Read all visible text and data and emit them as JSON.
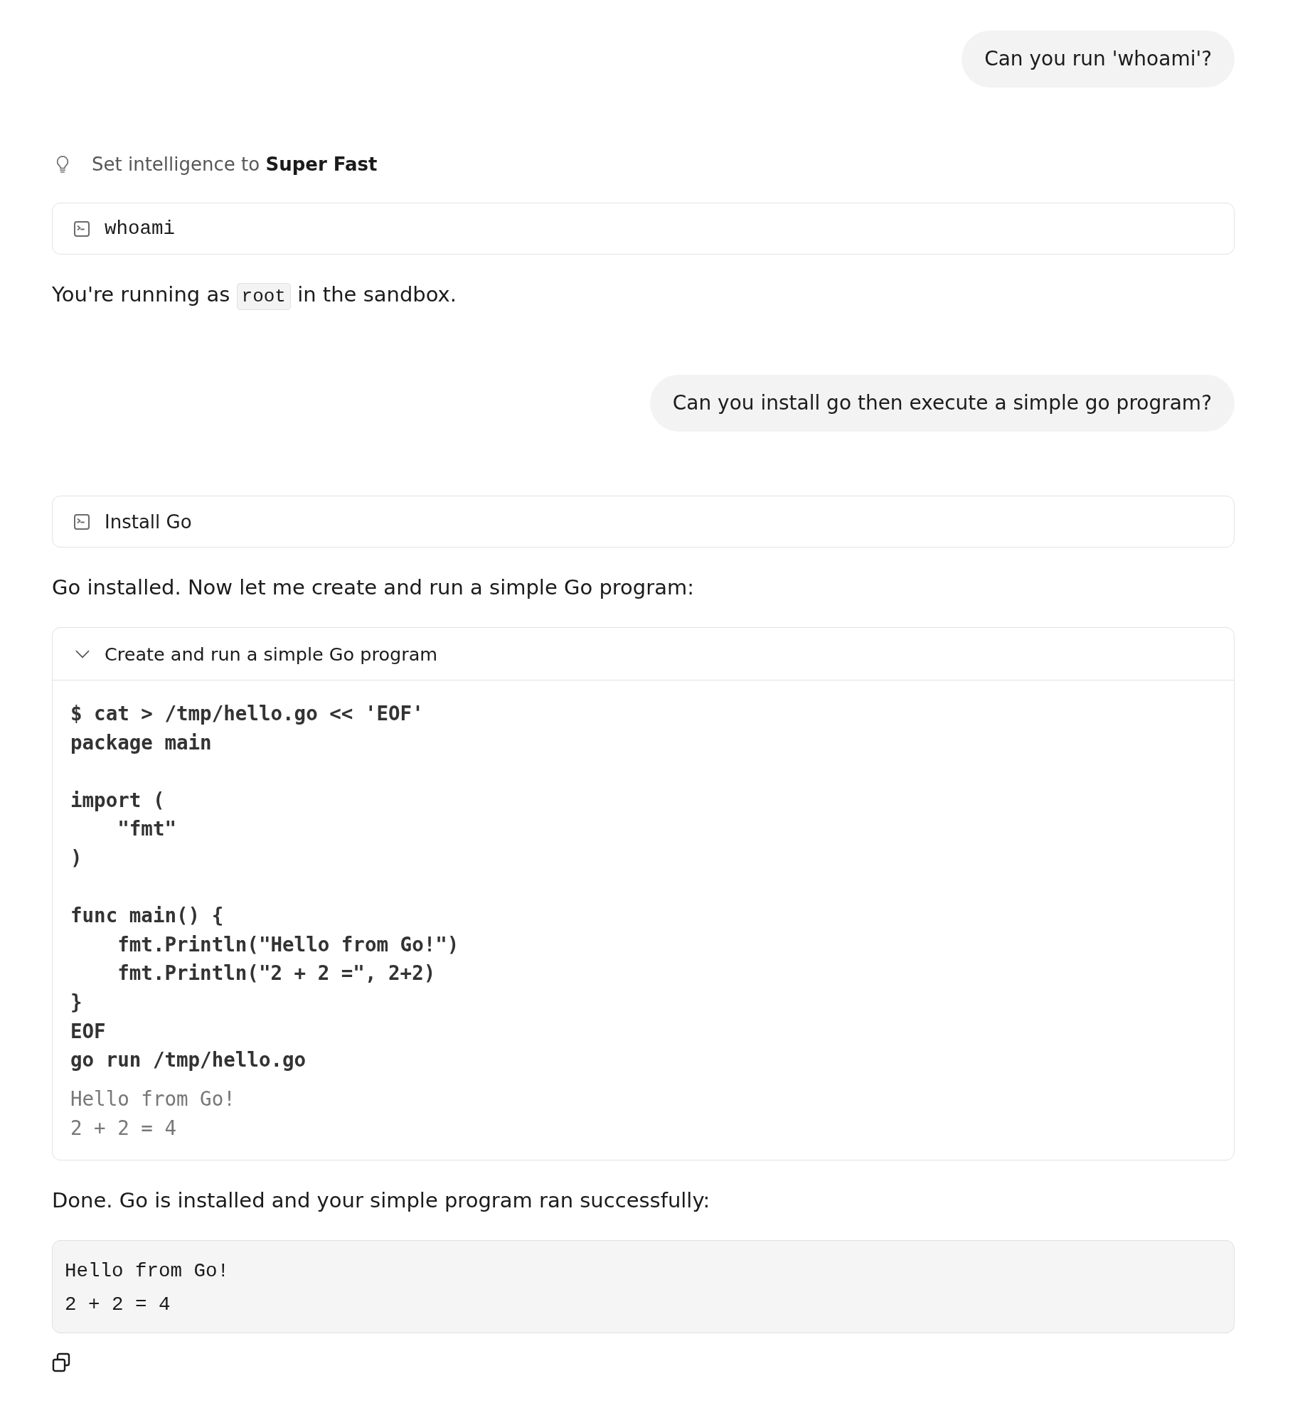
{
  "conversation": [
    {
      "kind": "user",
      "text": "Can you run 'whoami'?"
    },
    {
      "kind": "setting",
      "text": "Set intelligence to **Super Fast**"
    },
    {
      "kind": "command",
      "text": "whoami"
    },
    {
      "kind": "reply",
      "segments": [
        {
          "kind": "text",
          "text": "You're running as "
        },
        {
          "kind": "code",
          "text": "root"
        },
        {
          "kind": "text",
          "text": " in the sandbox."
        }
      ]
    },
    {
      "kind": "user",
      "text": "Can you install go then execute a simple go program?"
    },
    {
      "kind": "step",
      "text": "Install Go"
    },
    {
      "kind": "reply",
      "segments": [
        {
          "kind": "text",
          "text": "Go installed. Now let me create and run a simple Go program:"
        }
      ]
    },
    {
      "kind": "run",
      "title": "Create and run a simple Go program",
      "expanded": true,
      "command": "$ cat > /tmp/hello.go << 'EOF'\npackage main\n\nimport (\n    \"fmt\"\n)\n\nfunc main() {\n    fmt.Println(\"Hello from Go!\")\n    fmt.Println(\"2 + 2 =\", 2+2)\n}\nEOF\ngo run /tmp/hello.go",
      "output": "Hello from Go!\n2 + 2 = 4"
    },
    {
      "kind": "reply",
      "segments": [
        {
          "kind": "text",
          "text": "Done. Go is installed and your simple program ran successfully:"
        }
      ]
    },
    {
      "kind": "code_block",
      "text": "Hello from Go!\n2 + 2 = 4"
    }
  ]
}
